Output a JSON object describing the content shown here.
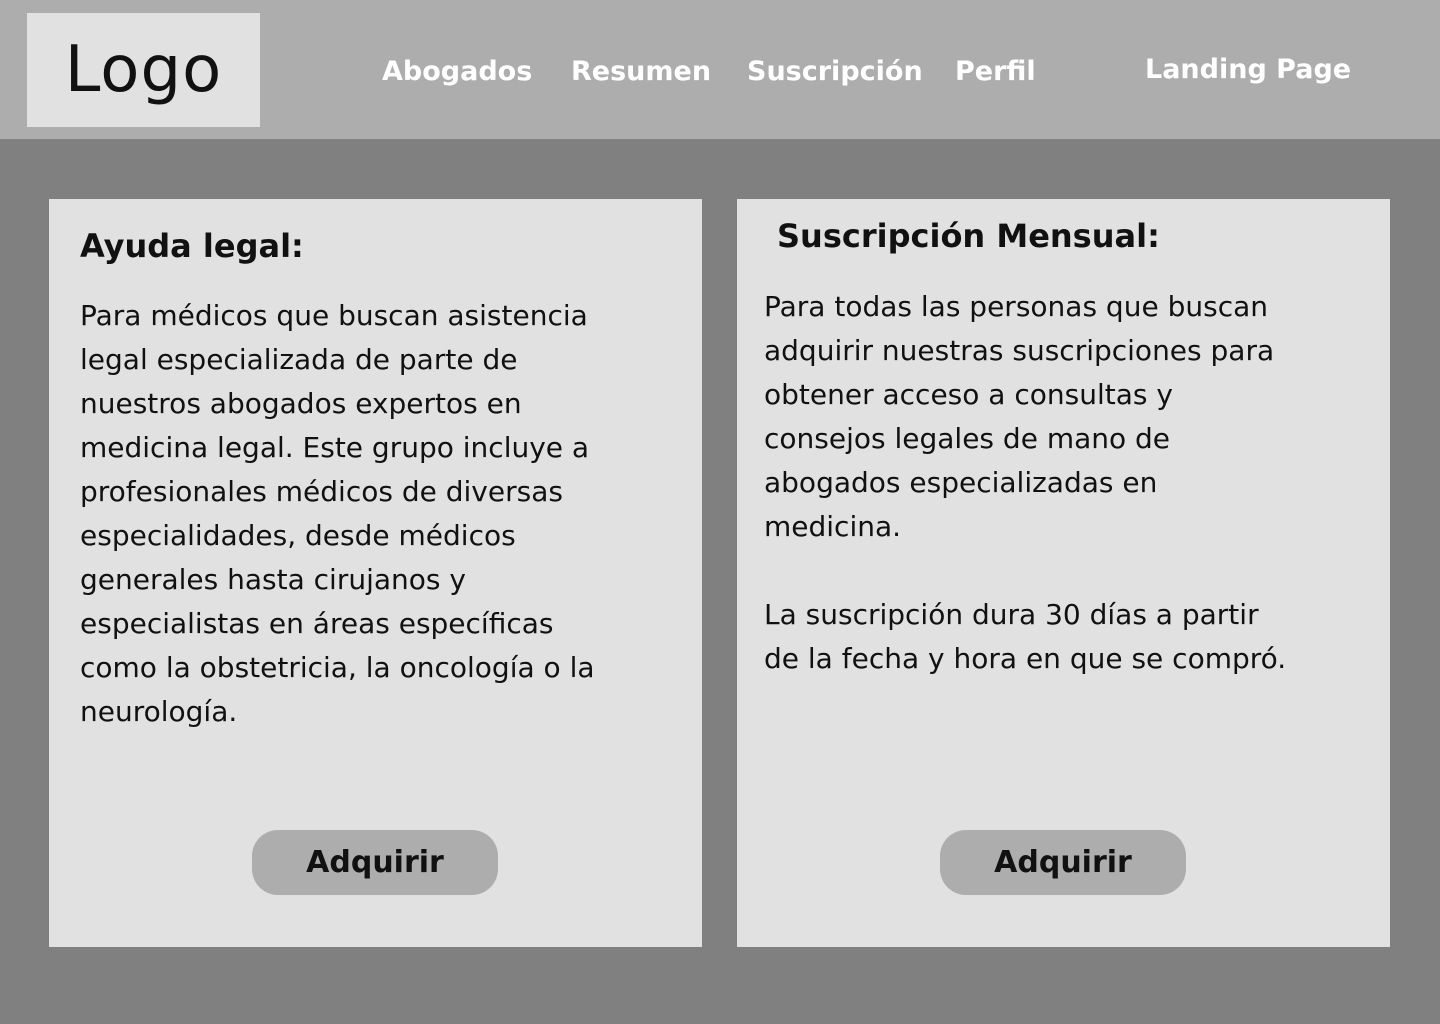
{
  "header": {
    "logo": "Logo",
    "nav": [
      {
        "label": "Abogados"
      },
      {
        "label": "Resumen"
      },
      {
        "label": "Suscripción"
      },
      {
        "label": "Perfil"
      },
      {
        "label": "Landing Page"
      }
    ]
  },
  "cards": [
    {
      "title": "Ayuda legal:",
      "text": "Para médicos que buscan asistencia\nlegal especializada de parte de\nnuestros abogados expertos en\nmedicina legal. Este grupo incluye a\nprofesionales médicos de diversas\nespecialidades, desde médicos\ngenerales hasta cirujanos y\nespecialistas en áreas específicas\ncomo la obstetricia, la oncología o la\nneurología.",
      "button": "Adquirir"
    },
    {
      "title": "Suscripción Mensual:",
      "text": "Para todas las personas que buscan\nadquirir nuestras suscripciones para\nobtener acceso a consultas y\nconsejos legales de mano de\nabogados especializadas en\nmedicina.\n\nLa suscripción dura 30 días a partir\nde la fecha y hora en que se compró.",
      "button": "Adquirir"
    }
  ]
}
